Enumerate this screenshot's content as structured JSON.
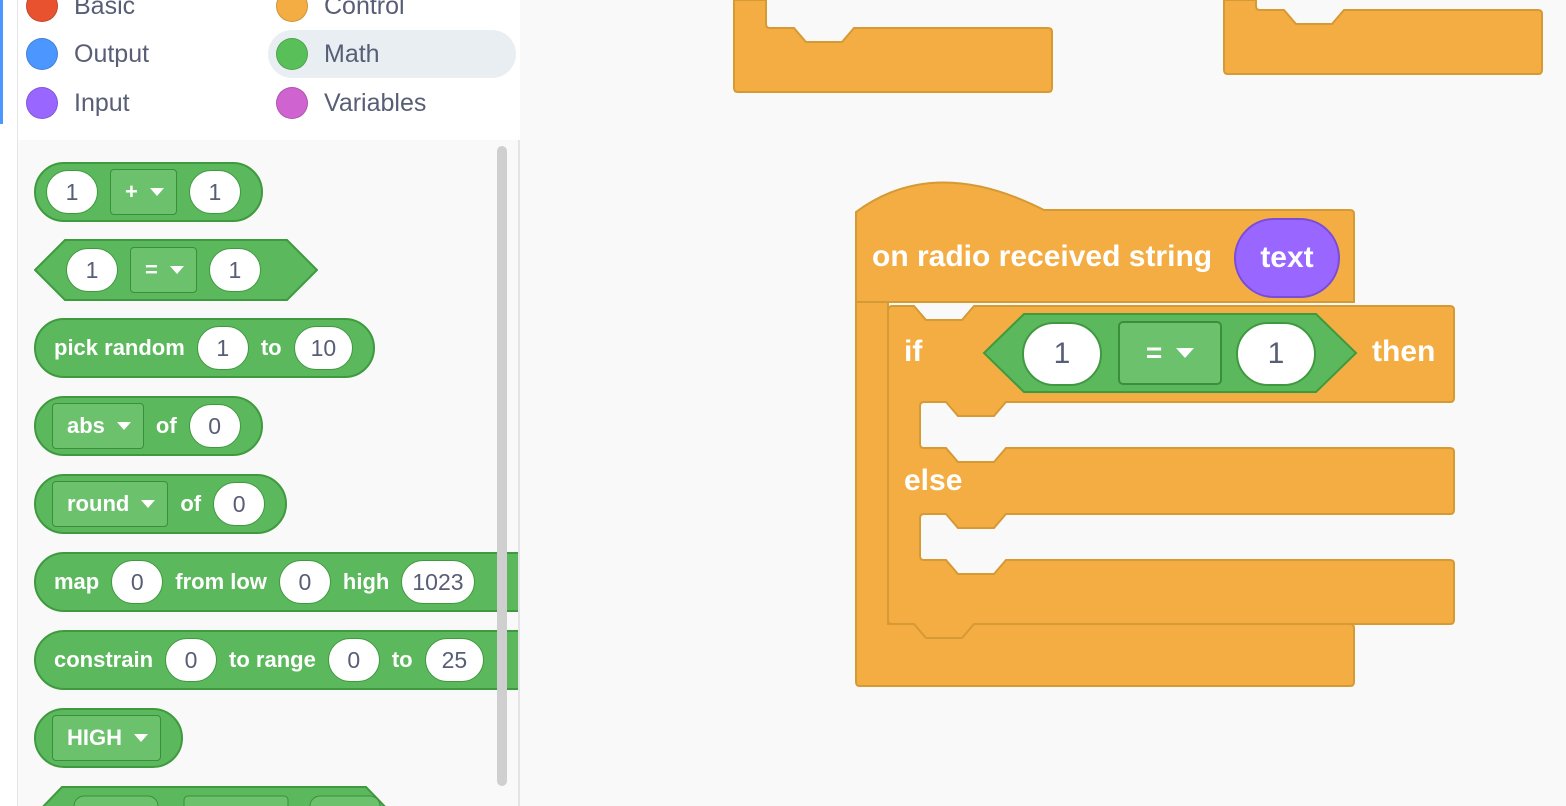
{
  "categories": [
    {
      "label": "Basic",
      "color": "#e8522f"
    },
    {
      "label": "Control",
      "color": "#f4ad42"
    },
    {
      "label": "Output",
      "color": "#4c97ff"
    },
    {
      "label": "Math",
      "color": "#59c059"
    },
    {
      "label": "Input",
      "color": "#9966ff"
    },
    {
      "label": "Variables",
      "color": "#cf63cf"
    }
  ],
  "selected_category": "Math",
  "flyout": {
    "add": {
      "a": "1",
      "op": "+",
      "b": "1"
    },
    "compare": {
      "a": "1",
      "op": "=",
      "b": "1"
    },
    "random": {
      "label": "pick random",
      "from": "1",
      "to_label": "to",
      "to": "10"
    },
    "abs": {
      "op": "abs",
      "of": "of",
      "value": "0"
    },
    "round": {
      "op": "round",
      "of": "of",
      "value": "0"
    },
    "map": {
      "label": "map",
      "value": "0",
      "from_low_label": "from low",
      "from_low": "0",
      "high_label": "high",
      "high": "1023"
    },
    "constrain": {
      "label": "constrain",
      "value": "0",
      "range_label": "to range",
      "low": "0",
      "to_label": "to",
      "high": "25"
    },
    "pin": {
      "value": "HIGH"
    }
  },
  "workspace": {
    "event": {
      "label": "on radio received string",
      "variable": "text"
    },
    "if": {
      "if_label": "if",
      "a": "1",
      "op": "=",
      "b": "1",
      "then_label": "then",
      "else_label": "else"
    }
  },
  "colors": {
    "control": "#f4ad42",
    "math": "#5cb85c",
    "variables": "#9966ff"
  }
}
